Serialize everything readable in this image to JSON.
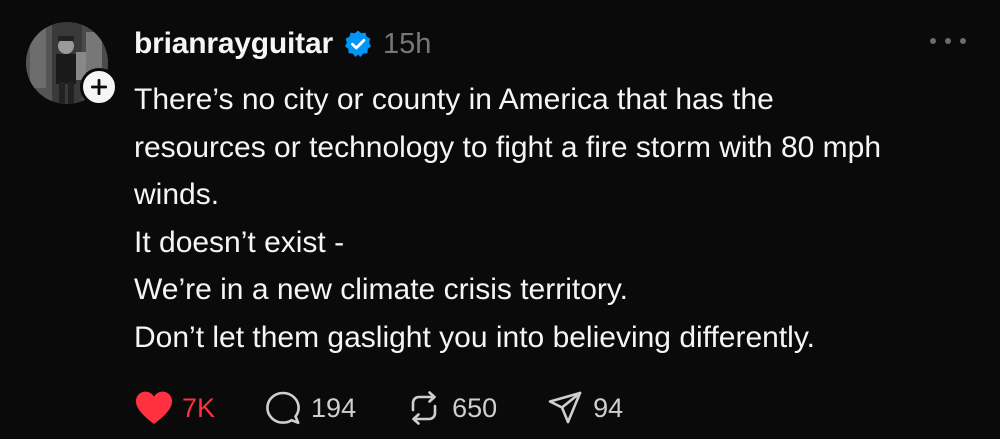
{
  "post": {
    "username": "brianrayguitar",
    "timestamp": "15h",
    "lines": [
      "There’s no city or county in America that has the",
      "resources or technology to fight a fire storm with 80 mph",
      "winds.",
      "It doesn’t exist -",
      "We’re in a new climate crisis territory.",
      "Don’t let them gaslight you into believing differently."
    ]
  },
  "actions": {
    "likes": "7K",
    "replies": "194",
    "reposts": "650",
    "shares": "94"
  },
  "icons": {
    "verified": "verified-badge-icon",
    "follow": "plus-icon",
    "more": "more-dots-icon",
    "like": "heart-icon",
    "reply": "comment-bubble-icon",
    "repost": "repost-arrows-icon",
    "share": "send-icon"
  },
  "colors": {
    "background": "#0a0a0a",
    "text": "#f3f5f7",
    "muted": "#777777",
    "like": "#ff3040",
    "verified": "#0095f6"
  }
}
